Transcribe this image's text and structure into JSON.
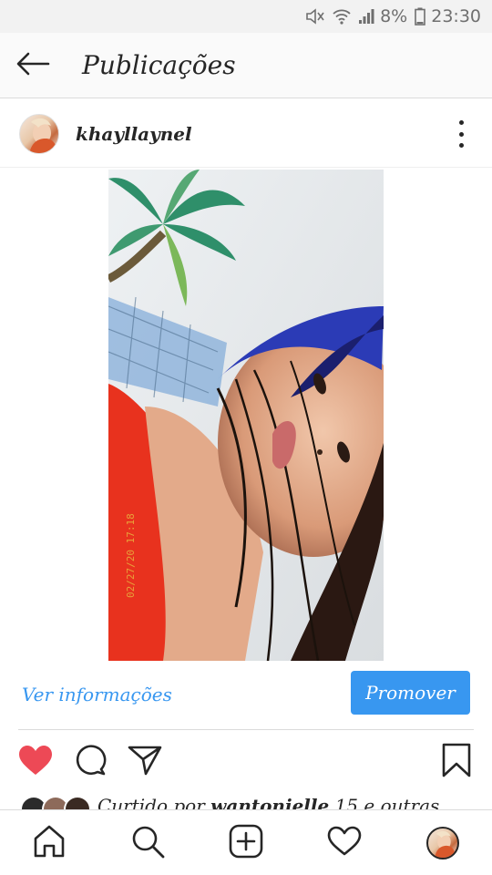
{
  "status_bar": {
    "battery": "8%",
    "time": "23:30",
    "icons": [
      "mute-icon",
      "wifi-icon",
      "signal-icon",
      "battery-icon"
    ]
  },
  "header": {
    "title": "Publicações",
    "back_icon": "back-arrow-icon"
  },
  "post": {
    "username": "khayllaynel",
    "photo_timestamp": "02/27/20 17:18",
    "info_link": "Ver informações",
    "promote_label": "Promover",
    "liked": true,
    "likes_prefix": "Curtido por ",
    "likes_user": "wantonielle",
    "likes_suffix": " 15 e outras"
  },
  "colors": {
    "accent": "#3897f0",
    "like_red": "#ed4956",
    "text": "#262626"
  },
  "bottom_nav": {
    "items": [
      "home-icon",
      "search-icon",
      "add-post-icon",
      "activity-heart-icon",
      "profile-avatar"
    ]
  }
}
